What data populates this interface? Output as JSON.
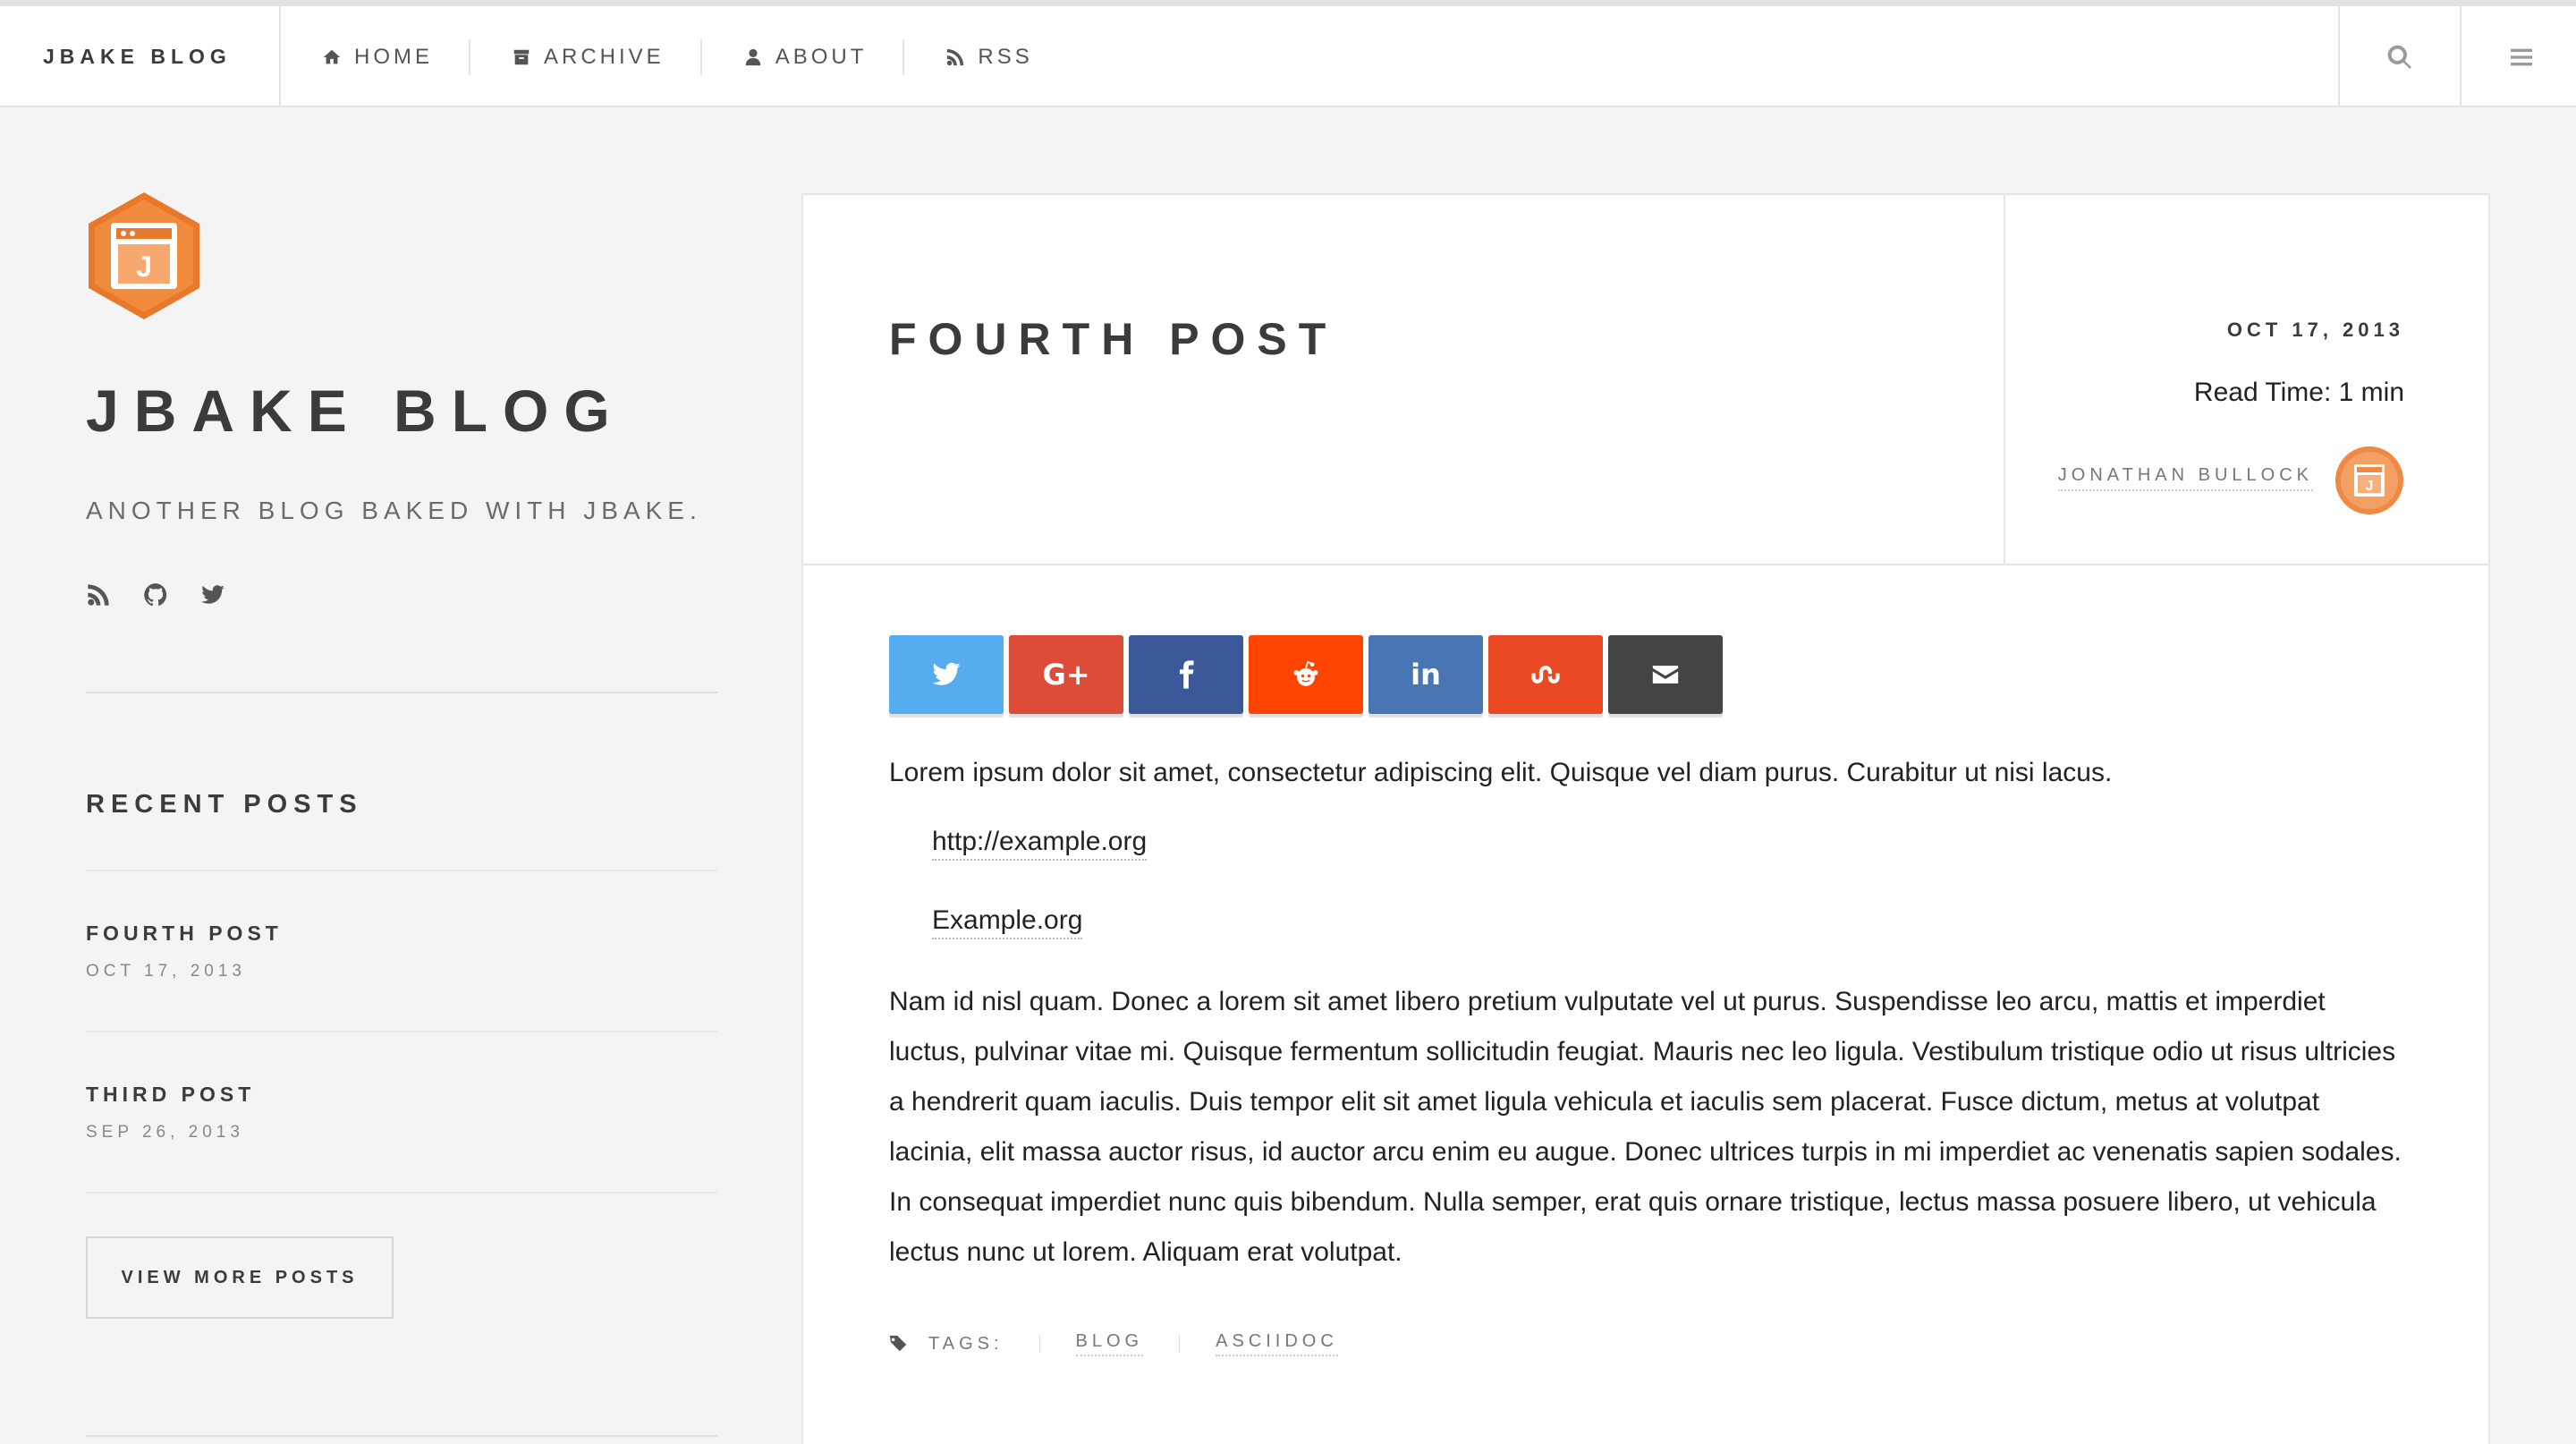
{
  "nav": {
    "brand": "JBAKE BLOG",
    "items": [
      {
        "label": "HOME",
        "icon": "home-icon"
      },
      {
        "label": "ARCHIVE",
        "icon": "archive-icon"
      },
      {
        "label": "ABOUT",
        "icon": "user-icon"
      },
      {
        "label": "RSS",
        "icon": "rss-icon"
      }
    ],
    "search_icon": "search-icon",
    "menu_icon": "hamburger-icon"
  },
  "sidebar": {
    "title": "JBAKE BLOG",
    "description": "ANOTHER BLOG BAKED WITH JBAKE.",
    "social_icons": [
      "rss-icon",
      "github-icon",
      "twitter-icon"
    ],
    "recent_title": "RECENT POSTS",
    "recent_posts": [
      {
        "title": "FOURTH POST",
        "date": "OCT 17, 2013"
      },
      {
        "title": "THIRD POST",
        "date": "SEP 26, 2013"
      }
    ],
    "more_label": "VIEW MORE POSTS"
  },
  "post": {
    "title": "FOURTH POST",
    "date": "OCT 17, 2013",
    "read_time": "Read Time: 1 min",
    "author": "JONATHAN BULLOCK",
    "share": [
      {
        "name": "twitter",
        "color": "#55acee"
      },
      {
        "name": "google-plus",
        "color": "#dd4b39"
      },
      {
        "name": "facebook",
        "color": "#3b5998"
      },
      {
        "name": "reddit",
        "color": "#ff4500"
      },
      {
        "name": "linkedin",
        "color": "#4875b4"
      },
      {
        "name": "stumbleupon",
        "color": "#eb4924"
      },
      {
        "name": "email",
        "color": "#444444"
      }
    ],
    "paragraph1": "Lorem ipsum dolor sit amet, consectetur adipiscing elit. Quisque vel diam purus. Curabitur ut nisi lacus.",
    "link1": "http://example.org",
    "link2": "Example.org",
    "paragraph2": "Nam id nisl quam. Donec a lorem sit amet libero pretium vulputate vel ut purus. Suspendisse leo arcu, mattis et imperdiet luctus, pulvinar vitae mi. Quisque fermentum sollicitudin feugiat. Mauris nec leo ligula. Vestibulum tristique odio ut risus ultricies a hendrerit quam iaculis. Duis tempor elit sit amet ligula vehicula et iaculis sem placerat. Fusce dictum, metus at volutpat lacinia, elit massa auctor risus, id auctor arcu enim eu augue. Donec ultrices turpis in mi imperdiet ac venenatis sapien sodales. In consequat imperdiet nunc quis bibendum. Nulla semper, erat quis ornare tristique, lectus massa posuere libero, ut vehicula lectus nunc ut lorem. Aliquam erat volutpat.",
    "tags_label": "TAGS:",
    "tags": [
      "BLOG",
      "ASCIIDOC"
    ]
  }
}
